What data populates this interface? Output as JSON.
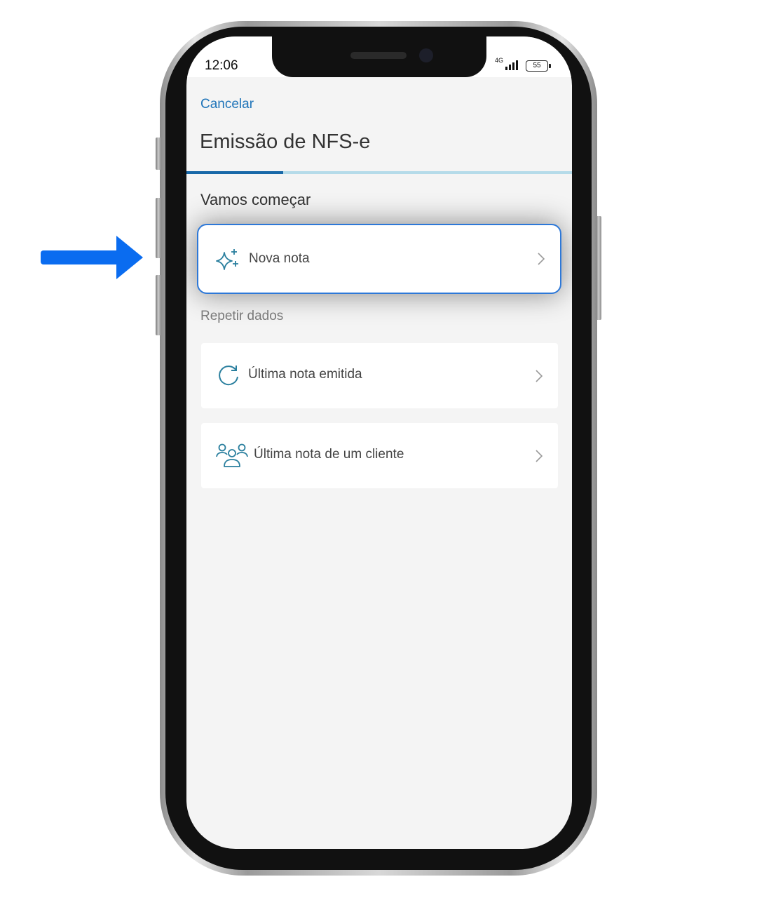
{
  "status": {
    "time": "12:06",
    "network": "4G",
    "battery": "55"
  },
  "header": {
    "cancel_label": "Cancelar",
    "title": "Emissão de NFS-e",
    "progress": 0.25
  },
  "start": {
    "heading": "Vamos começar",
    "new_note_label": "Nova nota"
  },
  "repeat": {
    "heading": "Repetir dados",
    "items": [
      {
        "label": "Última nota emitida",
        "icon": "refresh-icon"
      },
      {
        "label": "Última nota de um cliente",
        "icon": "users-icon"
      }
    ]
  },
  "colors": {
    "accent": "#1f74b9",
    "highlight_border": "#2d78d8",
    "arrow": "#0a6cf0",
    "icon": "#2a7f9e"
  }
}
